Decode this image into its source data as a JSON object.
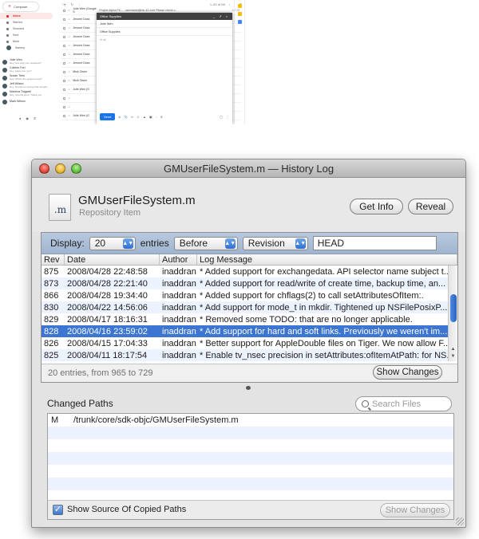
{
  "gmail": {
    "compose_label": "Compose",
    "nav": [
      {
        "label": "Inbox",
        "active": true
      },
      {
        "label": "Starred",
        "active": false
      },
      {
        "label": "Snoozed",
        "active": false
      },
      {
        "label": "Sent",
        "active": false
      },
      {
        "label": "More",
        "active": false
      }
    ],
    "user_label": "Sammy",
    "chats": [
      {
        "name": "Julie Wen",
        "status": "Hey, how was your weekend?"
      },
      {
        "name": "Colleen Fort",
        "status": "Hey, where are you?"
      },
      {
        "name": "Susan Tiers",
        "status": "Hey, What's the project name?"
      },
      {
        "name": "Jeff Wilson",
        "status": "Hey, Thanks for joining that thought"
      },
      {
        "name": "Marlena Tidgwell",
        "status": "Hey, Sounds good, Thank you"
      },
      {
        "name": "Mark Wilson",
        "status": ""
      }
    ],
    "pagination": "1–50 of 58",
    "rows": [
      {
        "sender": "Julie Wen (Google S",
        "subject": "Project Alpha Pit... - username@mk-42.com Please check c...",
        "date": "Jul 19"
      },
      {
        "sender": "Jerome Doss",
        "subject": "",
        "date": ""
      },
      {
        "sender": "Jerome Doss",
        "subject": "",
        "date": ""
      },
      {
        "sender": "Jerome Doss",
        "subject": "",
        "date": ""
      },
      {
        "sender": "Jerome Doss",
        "subject": "",
        "date": ""
      },
      {
        "sender": "Jerome Doss",
        "subject": "",
        "date": ""
      },
      {
        "sender": "Jerome Doss",
        "subject": "",
        "date": ""
      },
      {
        "sender": "Mick Owen",
        "subject": "",
        "date": ""
      },
      {
        "sender": "Mick Owen",
        "subject": "",
        "date": ""
      },
      {
        "sender": "Julie Wen (G",
        "subject": "",
        "date": ""
      },
      {
        "sender": "",
        "subject": "",
        "date": ""
      },
      {
        "sender": "",
        "subject": "",
        "date": ""
      },
      {
        "sender": "Julie Wen (G",
        "subject": "",
        "date": ""
      }
    ],
    "compose": {
      "title": "Office Supplies",
      "to": "Julie Wen",
      "subject": "Office Supplies",
      "body": "Hi all,",
      "send_label": "Send"
    }
  },
  "window": {
    "title": "GMUserFileSystem.m — History Log",
    "file_name": "GMUserFileSystem.m",
    "file_ext": ".m",
    "file_kind": "Repository Item",
    "get_info_label": "Get Info",
    "reveal_label": "Reveal",
    "display_label": "Display:",
    "display_count": "20",
    "entries_label": "entries",
    "direction": "Before",
    "field_kind": "Revision",
    "head_value": "HEAD",
    "columns": [
      "Rev",
      "Date",
      "Author",
      "Log Message"
    ],
    "rows": [
      {
        "rev": "875",
        "date": "2008/04/28 22:48:58",
        "author": "inaddran",
        "msg": "* Added support for exchangedata. API selector name subject t...",
        "selected": false
      },
      {
        "rev": "873",
        "date": "2008/04/28 22:21:40",
        "author": "inaddran",
        "msg": "* Added support for read/write of create time, backup time, an...",
        "selected": false
      },
      {
        "rev": "866",
        "date": "2008/04/28 19:34:40",
        "author": "inaddran",
        "msg": "* Added support for chflags(2) to call setAttributesOfItem:.",
        "selected": false
      },
      {
        "rev": "830",
        "date": "2008/04/22 14:56:06",
        "author": "inaddran",
        "msg": "* Add support for mode_t in mkdir. Tightened up NSFilePosixP...",
        "selected": false
      },
      {
        "rev": "829",
        "date": "2008/04/17 18:16:31",
        "author": "inaddran",
        "msg": "* Removed some TODO: that are no longer applicable.",
        "selected": false
      },
      {
        "rev": "828",
        "date": "2008/04/16 23:59:02",
        "author": "inaddran",
        "msg": "* Add support for hard and soft links. Previously we weren't im...",
        "selected": true
      },
      {
        "rev": "826",
        "date": "2008/04/15 17:04:33",
        "author": "inaddran",
        "msg": "* Better support for AppleDouble files on Tiger. We now allow F...",
        "selected": false
      },
      {
        "rev": "825",
        "date": "2008/04/11 18:17:54",
        "author": "inaddran",
        "msg": "* Enable tv_nsec precision in setAttributes:ofItemAtPath: for NS...",
        "selected": false
      }
    ],
    "summary": "20 entries, from 965 to 729",
    "show_changes_label": "Show Changes",
    "changed_paths_label": "Changed Paths",
    "search_placeholder": "Search Files",
    "paths": [
      {
        "action": "M",
        "path": "/trunk/core/sdk-objc/GMUserFileSystem.m"
      }
    ],
    "show_source_label": "Show Source Of Copied Paths",
    "show_source_checked": true,
    "show_changes_label_2": "Show Changes"
  },
  "colors": {
    "selection": "#3c75d2",
    "gmail_red": "#d93025",
    "send_blue": "#1a73e8"
  }
}
